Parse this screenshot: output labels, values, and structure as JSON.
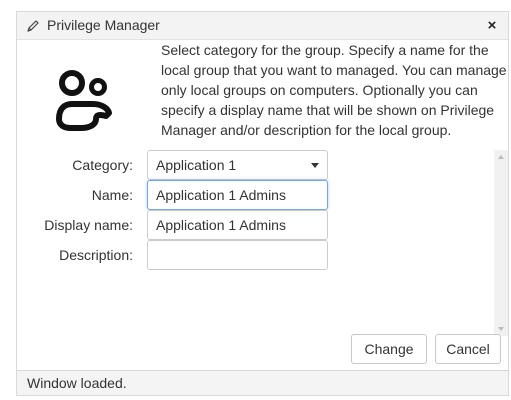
{
  "window": {
    "title": "Privilege Manager",
    "title_icon": "pencil-icon",
    "close_glyph": "×",
    "close_icon": "close-icon"
  },
  "intro": {
    "icon": "users-icon",
    "text": "Select category for the group. Specify a name for the local group that you want to managed. You can manage only local groups on computers. Optionally you can specify a display name that will be shown on Privilege Manager and/or description for the local group."
  },
  "form": {
    "category": {
      "label": "Category:",
      "value": "Application 1"
    },
    "name": {
      "label": "Name:",
      "value": "Application 1 Admins"
    },
    "display_name": {
      "label": "Display name:",
      "value": "Application 1 Admins"
    },
    "description": {
      "label": "Description:",
      "value": ""
    }
  },
  "buttons": {
    "change": "Change",
    "cancel": "Cancel"
  },
  "status": {
    "text": "Window loaded."
  },
  "colors": {
    "focus_border": "#74a8e0",
    "title_bar": "#f3f3f3",
    "status_bar": "#f4f4f4"
  }
}
